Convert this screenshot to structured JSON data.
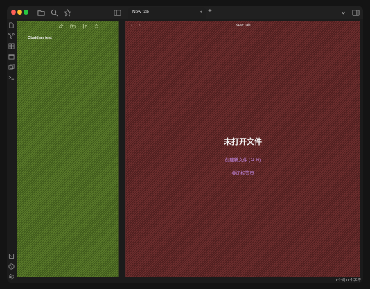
{
  "window": {
    "tab_title": "New tab",
    "tab_close": "×",
    "new_tab": "+",
    "traffic_lights": [
      "#ff5f57",
      "#febc2e",
      "#28c840"
    ]
  },
  "titlebar_icons": [
    "folder-icon",
    "search-icon",
    "star-icon",
    "sidebar-toggle-icon",
    "chevron-down-icon",
    "right-sidebar-icon"
  ],
  "ribbon_icons": [
    "file-icon",
    "graph-icon",
    "canvas-icon",
    "calendar-icon",
    "copy-icon",
    "terminal-icon",
    "vault-switcher-icon",
    "help-icon",
    "settings-icon"
  ],
  "sidebar": {
    "vault_name": "Obsidian test",
    "toolbar": [
      "new-note-icon",
      "new-folder-icon",
      "sort-icon",
      "collapse-icon"
    ]
  },
  "main": {
    "nav_arrows": "‹ ›",
    "view_title": "New tab",
    "view_menu": "⋮",
    "empty_title": "未打开文件",
    "create_file": "创建新文件 (⌘ N)",
    "close_tab": "关闭标签页"
  },
  "statusbar": {
    "text": "0 个词  0 个字符"
  },
  "colors": {
    "sidebar_fill": "#5a7a2a",
    "main_fill": "#6e2e2e",
    "accent_link": "#c58ce8"
  }
}
